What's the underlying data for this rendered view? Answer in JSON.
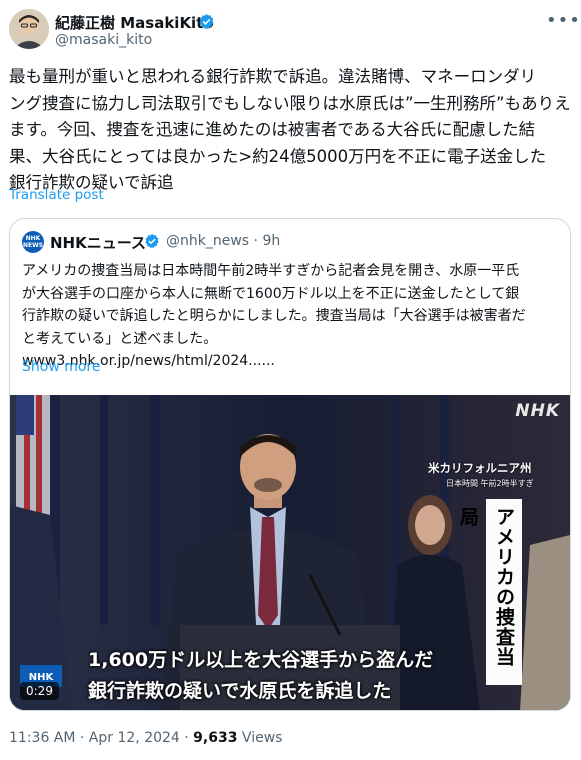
{
  "author": {
    "name": "紀藤正樹 MasakiKito",
    "handle": "@masaki_kito"
  },
  "tweet": {
    "text": "最も量刑が重いと思われる銀行詐欺で訴追。違法賭博、マネーロンダリ\nング捜査に協力し司法取引でもしない限りは水原氏は”一生刑務所”もありえ\nます。今回、捜査を迅速に進めたのは被害者である大谷氏に配慮した結\n果、大谷氏にとっては良かった>約24億5000万円を不正に電子送金した\n銀行詐欺の疑いで訴追",
    "translate_label": "Translate post"
  },
  "quote": {
    "logo_text": "NHK NEWS",
    "name": "NHKニュース",
    "handle": "@nhk_news",
    "time": "9h",
    "text": "アメリカの捜査当局は日本時間午前2時半すぎから記者会見を開き、水原一平氏\nが大谷選手の口座から本人に無断で1600万ドル以上を不正に送金したとして銀\n行詐欺の疑いで訴追したと明らかにしました。捜査当局は「大谷選手は被害者だ\nと考えている」と述べました。\nwww3.nhk.or.jp/news/html/2024......",
    "show_more": "Show more",
    "video": {
      "watermark": "NHK",
      "location": "米カリフォルニア州",
      "time_label": "日本時間 午前2時半すぎ",
      "vertical_caption": "アメリカの捜査当局",
      "subtitle_line1": "1,600万ドル以上を大谷選手から盗んだ",
      "subtitle_line2": "銀行詐欺の疑いで水原氏を訴追した",
      "channel_badge": "NHK",
      "duration": "0:29"
    }
  },
  "footer": {
    "time": "11:36 AM · Apr 12, 2024 · ",
    "views_count": "9,633",
    "views_label": " Views"
  },
  "colors": {
    "accent": "#1d9bf0",
    "muted": "#536471",
    "border": "#cfd9de",
    "nhk_blue": "#0d5cb5"
  },
  "icons": [
    "avatar",
    "verified-badge-icon",
    "more-options-icon",
    "nhk-logo-icon",
    "video-duration-badge"
  ]
}
